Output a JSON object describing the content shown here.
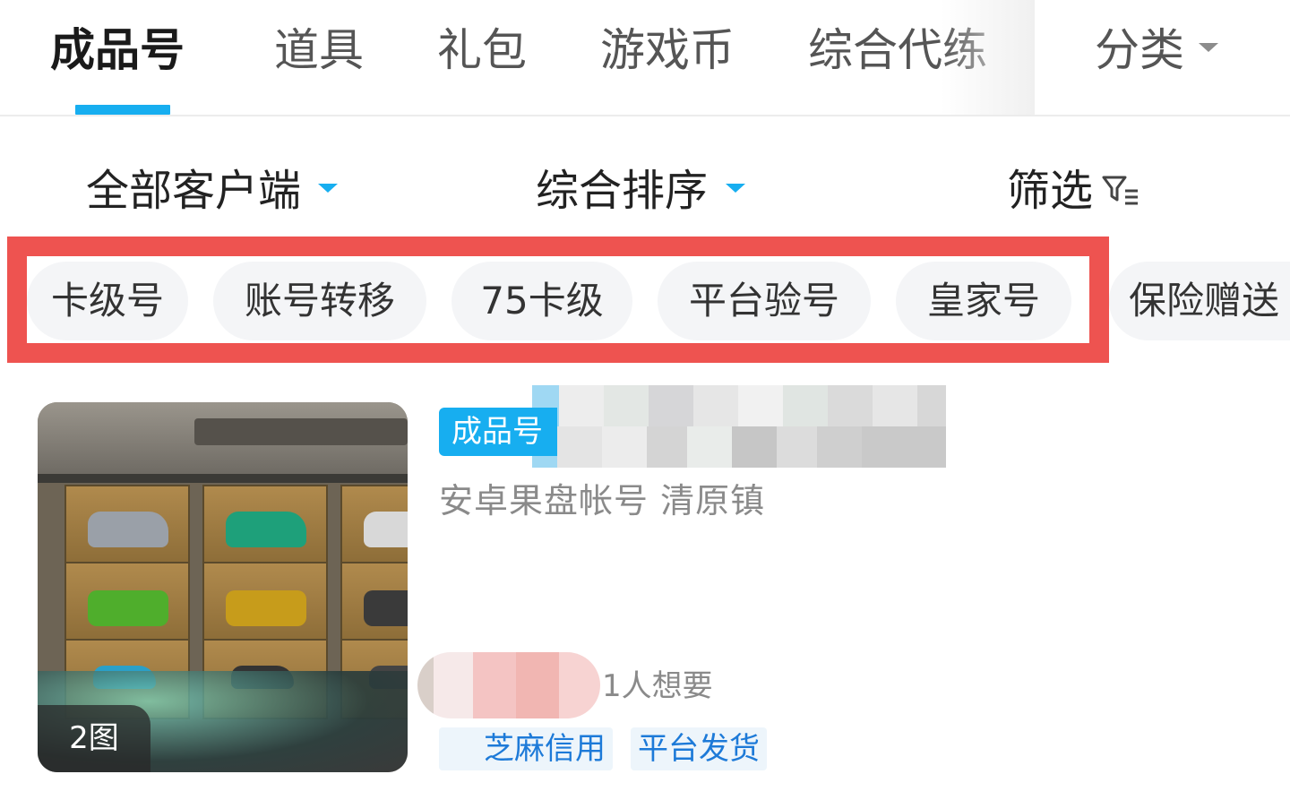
{
  "top_tabs": {
    "items": [
      {
        "label": "成品号",
        "active": true
      },
      {
        "label": "道具",
        "active": false
      },
      {
        "label": "礼包",
        "active": false
      },
      {
        "label": "游戏币",
        "active": false
      },
      {
        "label": "综合代练",
        "active": false
      }
    ],
    "category_label": "分类",
    "accent_color": "#17aef0"
  },
  "filters": {
    "client_label": "全部客户端",
    "sort_label": "综合排序",
    "filter_label": "筛选"
  },
  "chips": [
    "卡级号",
    "账号转移",
    "75卡级",
    "平台验号",
    "皇家号",
    "保险赠送"
  ],
  "highlight_color": "#ee5350",
  "listing": {
    "image_count": "2图",
    "badge": "成品号",
    "subtitle": "安卓果盘帐号  清原镇",
    "wants": "1人想要",
    "tags": [
      "芝麻信用",
      "平台发货"
    ]
  }
}
